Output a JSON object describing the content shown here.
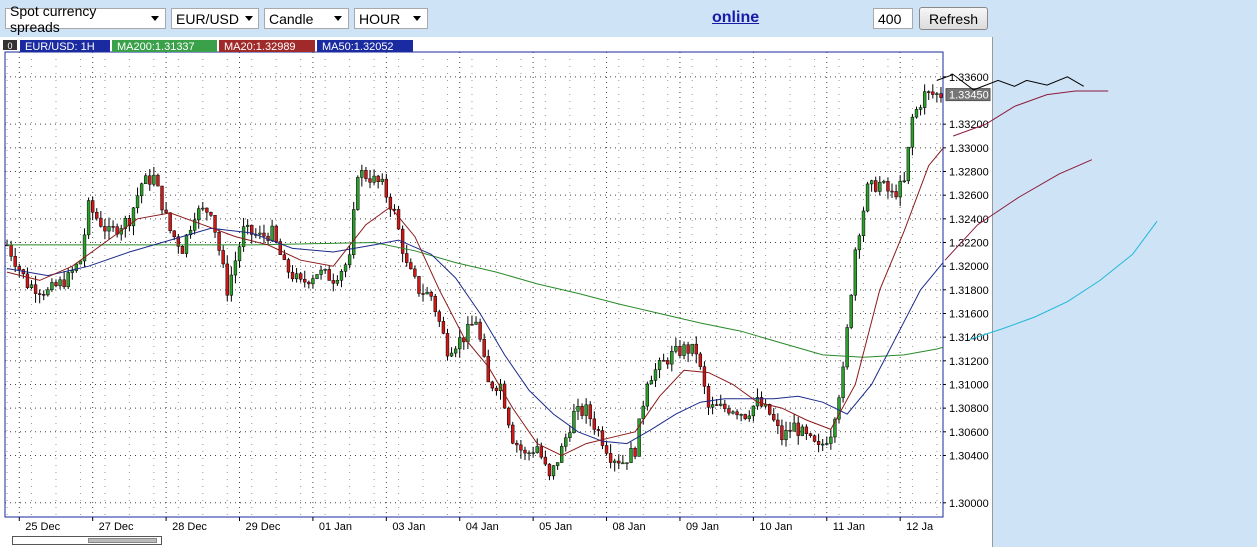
{
  "toolbar": {
    "chart_type": "Spot currency spreads",
    "symbol": "EUR/USD",
    "style": "Candle",
    "period": "HOUR",
    "status": "online",
    "count": "400",
    "refresh_label": "Refresh"
  },
  "legend": {
    "menu_glyph": "0",
    "items": [
      {
        "label": "EUR/USD: 1H",
        "bg": "#1a2aa0"
      },
      {
        "label": "MA200:1.31337",
        "bg": "#3aa04a"
      },
      {
        "label": "MA20:1.32989",
        "bg": "#a02a2a"
      },
      {
        "label": "MA50:1.32052",
        "bg": "#1a2aa0"
      }
    ]
  },
  "current_price": "1.33450",
  "colors": {
    "up": "#2ca02c",
    "down": "#d01818",
    "ma20": "#8b1a1a",
    "ma50": "#1a2a8b",
    "ma200": "#2a8a2a",
    "frame": "#1a2aa0"
  },
  "chart_data": {
    "type": "candlestick",
    "ylim": [
      1.2988,
      1.3381
    ],
    "y_ticks": [
      "1.33600",
      "1.33200",
      "1.33000",
      "1.32800",
      "1.32600",
      "1.32400",
      "1.32200",
      "1.32000",
      "1.31800",
      "1.31600",
      "1.31400",
      "1.31200",
      "1.31000",
      "1.30800",
      "1.30600",
      "1.30400",
      "1.30000"
    ],
    "x_labels": [
      "25 Dec",
      "27 Dec",
      "28 Dec",
      "29 Dec",
      "01 Jan",
      "03 Jan",
      "04 Jan",
      "05 Jan",
      "08 Jan",
      "09 Jan",
      "10 Jan",
      "11 Jan",
      "12 Ja"
    ],
    "close_path": [
      [
        0,
        1.3218
      ],
      [
        5,
        1.3185
      ],
      [
        10,
        1.3178
      ],
      [
        15,
        1.319
      ],
      [
        18,
        1.3205
      ],
      [
        20,
        1.325
      ],
      [
        25,
        1.3228
      ],
      [
        30,
        1.324
      ],
      [
        33,
        1.327
      ],
      [
        36,
        1.3275
      ],
      [
        40,
        1.323
      ],
      [
        43,
        1.3215
      ],
      [
        46,
        1.3245
      ],
      [
        50,
        1.3248
      ],
      [
        54,
        1.318
      ],
      [
        58,
        1.323
      ],
      [
        62,
        1.3225
      ],
      [
        65,
        1.3228
      ],
      [
        68,
        1.32
      ],
      [
        72,
        1.3185
      ],
      [
        76,
        1.3195
      ],
      [
        80,
        1.319
      ],
      [
        84,
        1.3205
      ],
      [
        86,
        1.328
      ],
      [
        89,
        1.3275
      ],
      [
        92,
        1.3268
      ],
      [
        95,
        1.3245
      ],
      [
        98,
        1.32
      ],
      [
        101,
        1.318
      ],
      [
        104,
        1.3175
      ],
      [
        108,
        1.313
      ],
      [
        112,
        1.314
      ],
      [
        115,
        1.3155
      ],
      [
        118,
        1.31
      ],
      [
        121,
        1.31
      ],
      [
        124,
        1.3055
      ],
      [
        127,
        1.304
      ],
      [
        130,
        1.3048
      ],
      [
        133,
        1.302
      ],
      [
        136,
        1.3045
      ],
      [
        139,
        1.3075
      ],
      [
        142,
        1.3078
      ],
      [
        145,
        1.306
      ],
      [
        148,
        1.304
      ],
      [
        151,
        1.3035
      ],
      [
        154,
        1.3045
      ],
      [
        157,
        1.3105
      ],
      [
        160,
        1.3115
      ],
      [
        163,
        1.3125
      ],
      [
        166,
        1.313
      ],
      [
        169,
        1.3128
      ],
      [
        172,
        1.308
      ],
      [
        175,
        1.308
      ],
      [
        178,
        1.308
      ],
      [
        181,
        1.3075
      ],
      [
        184,
        1.3085
      ],
      [
        187,
        1.3075
      ],
      [
        190,
        1.3055
      ],
      [
        193,
        1.3065
      ],
      [
        196,
        1.3055
      ],
      [
        199,
        1.3045
      ],
      [
        202,
        1.306
      ],
      [
        205,
        1.311
      ],
      [
        208,
        1.3215
      ],
      [
        211,
        1.3265
      ],
      [
        214,
        1.327
      ],
      [
        217,
        1.326
      ],
      [
        220,
        1.327
      ],
      [
        222,
        1.3325
      ],
      [
        225,
        1.3345
      ],
      [
        228,
        1.3345
      ]
    ],
    "ma20_path": [
      [
        0,
        1.3195
      ],
      [
        8,
        1.3188
      ],
      [
        16,
        1.32
      ],
      [
        24,
        1.322
      ],
      [
        32,
        1.324
      ],
      [
        40,
        1.3245
      ],
      [
        48,
        1.3235
      ],
      [
        56,
        1.3225
      ],
      [
        64,
        1.3218
      ],
      [
        72,
        1.3205
      ],
      [
        80,
        1.32
      ],
      [
        88,
        1.3235
      ],
      [
        94,
        1.325
      ],
      [
        100,
        1.3225
      ],
      [
        106,
        1.318
      ],
      [
        112,
        1.314
      ],
      [
        118,
        1.3115
      ],
      [
        124,
        1.308
      ],
      [
        130,
        1.305
      ],
      [
        136,
        1.304
      ],
      [
        142,
        1.305
      ],
      [
        148,
        1.3055
      ],
      [
        154,
        1.306
      ],
      [
        160,
        1.309
      ],
      [
        166,
        1.3112
      ],
      [
        172,
        1.311
      ],
      [
        178,
        1.31
      ],
      [
        184,
        1.3085
      ],
      [
        190,
        1.308
      ],
      [
        196,
        1.307
      ],
      [
        202,
        1.3062
      ],
      [
        208,
        1.31
      ],
      [
        214,
        1.318
      ],
      [
        220,
        1.323
      ],
      [
        226,
        1.3285
      ],
      [
        232,
        1.331
      ],
      [
        240,
        1.332
      ],
      [
        247,
        1.3335
      ],
      [
        255,
        1.3345
      ],
      [
        262,
        1.3348
      ],
      [
        270,
        1.3348
      ]
    ],
    "ma50_path": [
      [
        0,
        1.3198
      ],
      [
        10,
        1.3192
      ],
      [
        20,
        1.32
      ],
      [
        30,
        1.3212
      ],
      [
        40,
        1.3222
      ],
      [
        50,
        1.3232
      ],
      [
        60,
        1.3228
      ],
      [
        70,
        1.3215
      ],
      [
        80,
        1.3212
      ],
      [
        90,
        1.3218
      ],
      [
        96,
        1.3222
      ],
      [
        104,
        1.321
      ],
      [
        110,
        1.319
      ],
      [
        116,
        1.316
      ],
      [
        122,
        1.3125
      ],
      [
        128,
        1.3095
      ],
      [
        134,
        1.3075
      ],
      [
        140,
        1.306
      ],
      [
        146,
        1.3052
      ],
      [
        152,
        1.305
      ],
      [
        158,
        1.3062
      ],
      [
        164,
        1.3075
      ],
      [
        170,
        1.3085
      ],
      [
        176,
        1.3088
      ],
      [
        182,
        1.3088
      ],
      [
        188,
        1.3088
      ],
      [
        194,
        1.309
      ],
      [
        200,
        1.3085
      ],
      [
        206,
        1.3075
      ],
      [
        212,
        1.31
      ],
      [
        218,
        1.314
      ],
      [
        224,
        1.318
      ],
      [
        230,
        1.3205
      ],
      [
        238,
        1.3235
      ],
      [
        248,
        1.3258
      ],
      [
        258,
        1.3278
      ],
      [
        266,
        1.329
      ]
    ],
    "ma200_path": [
      [
        0,
        1.3218
      ],
      [
        30,
        1.3218
      ],
      [
        60,
        1.3218
      ],
      [
        90,
        1.322
      ],
      [
        100,
        1.3213
      ],
      [
        110,
        1.3203
      ],
      [
        120,
        1.3195
      ],
      [
        130,
        1.3185
      ],
      [
        140,
        1.3177
      ],
      [
        150,
        1.3168
      ],
      [
        160,
        1.316
      ],
      [
        170,
        1.3152
      ],
      [
        180,
        1.3145
      ],
      [
        190,
        1.3135
      ],
      [
        200,
        1.3125
      ],
      [
        210,
        1.3123
      ],
      [
        220,
        1.3125
      ],
      [
        228,
        1.313
      ],
      [
        236,
        1.3138
      ],
      [
        244,
        1.3147
      ],
      [
        252,
        1.3157
      ],
      [
        260,
        1.317
      ],
      [
        268,
        1.3188
      ],
      [
        276,
        1.321
      ],
      [
        282,
        1.3238
      ]
    ],
    "projection_path": [
      [
        228,
        1.3357
      ],
      [
        232,
        1.3362
      ],
      [
        237,
        1.3349
      ],
      [
        243,
        1.3357
      ],
      [
        247,
        1.3352
      ],
      [
        250,
        1.3357
      ],
      [
        255,
        1.3353
      ],
      [
        260,
        1.336
      ],
      [
        264,
        1.3352
      ]
    ],
    "visible_bars": 230,
    "total_bars": 284
  }
}
